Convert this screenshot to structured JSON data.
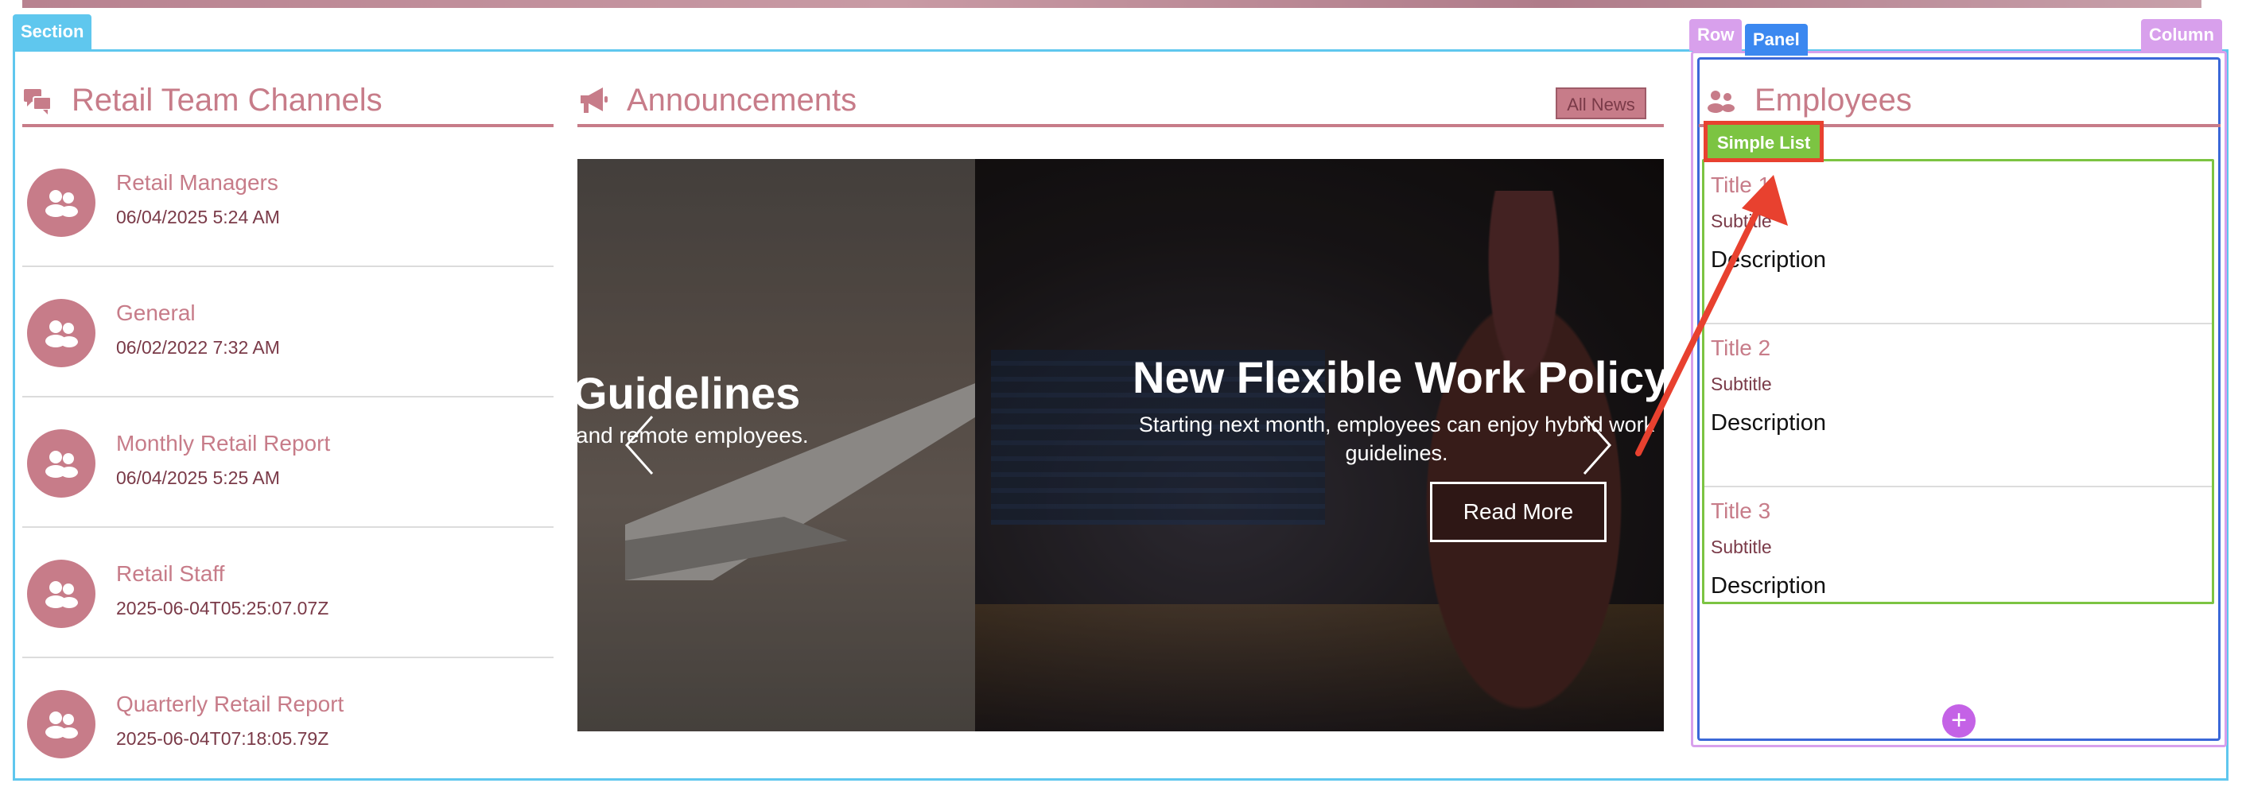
{
  "tags": {
    "section": "Section",
    "row": "Row",
    "panel": "Panel",
    "column": "Column",
    "simple_list": "Simple List"
  },
  "channels": {
    "heading": "Retail Team Channels",
    "icon": "chat-bubbles-icon",
    "items": [
      {
        "name": "Retail Managers",
        "date": "06/04/2025 5:24 AM",
        "icon": "group-icon"
      },
      {
        "name": "General",
        "date": "06/02/2022 7:32 AM",
        "icon": "group-icon"
      },
      {
        "name": "Monthly Retail Report",
        "date": "06/04/2025 5:25 AM",
        "icon": "group-icon"
      },
      {
        "name": "Retail Staff",
        "date": "2025-06-04T05:25:07.07Z",
        "icon": "group-icon"
      },
      {
        "name": "Quarterly Retail Report",
        "date": "2025-06-04T07:18:05.79Z",
        "icon": "group-icon"
      }
    ]
  },
  "announcements": {
    "heading": "Announcements",
    "icon": "megaphone-icon",
    "all_news_label": "All News",
    "slides": [
      {
        "title": "Guidelines",
        "text": "and remote employees."
      },
      {
        "title": "New Flexible Work Policy",
        "text": "Starting next month, employees can enjoy hybrid work guidelines.",
        "button": "Read More"
      }
    ]
  },
  "employees": {
    "heading": "Employees",
    "icon": "people-icon",
    "items": [
      {
        "title": "Title 1",
        "subtitle": "Subtitle",
        "description": "Description"
      },
      {
        "title": "Title 2",
        "subtitle": "Subtitle",
        "description": "Description"
      },
      {
        "title": "Title 3",
        "subtitle": "Subtitle",
        "description": "Description"
      }
    ],
    "add_label": "+"
  },
  "colors": {
    "accent": "#c77c89",
    "accent_dark": "#7a3a48",
    "section_outline": "#5fc7ee",
    "panel_blue": "#3b88f0",
    "row_purple": "#d8a0ec",
    "list_green": "#7cc442",
    "highlight_red": "#e8412f"
  }
}
